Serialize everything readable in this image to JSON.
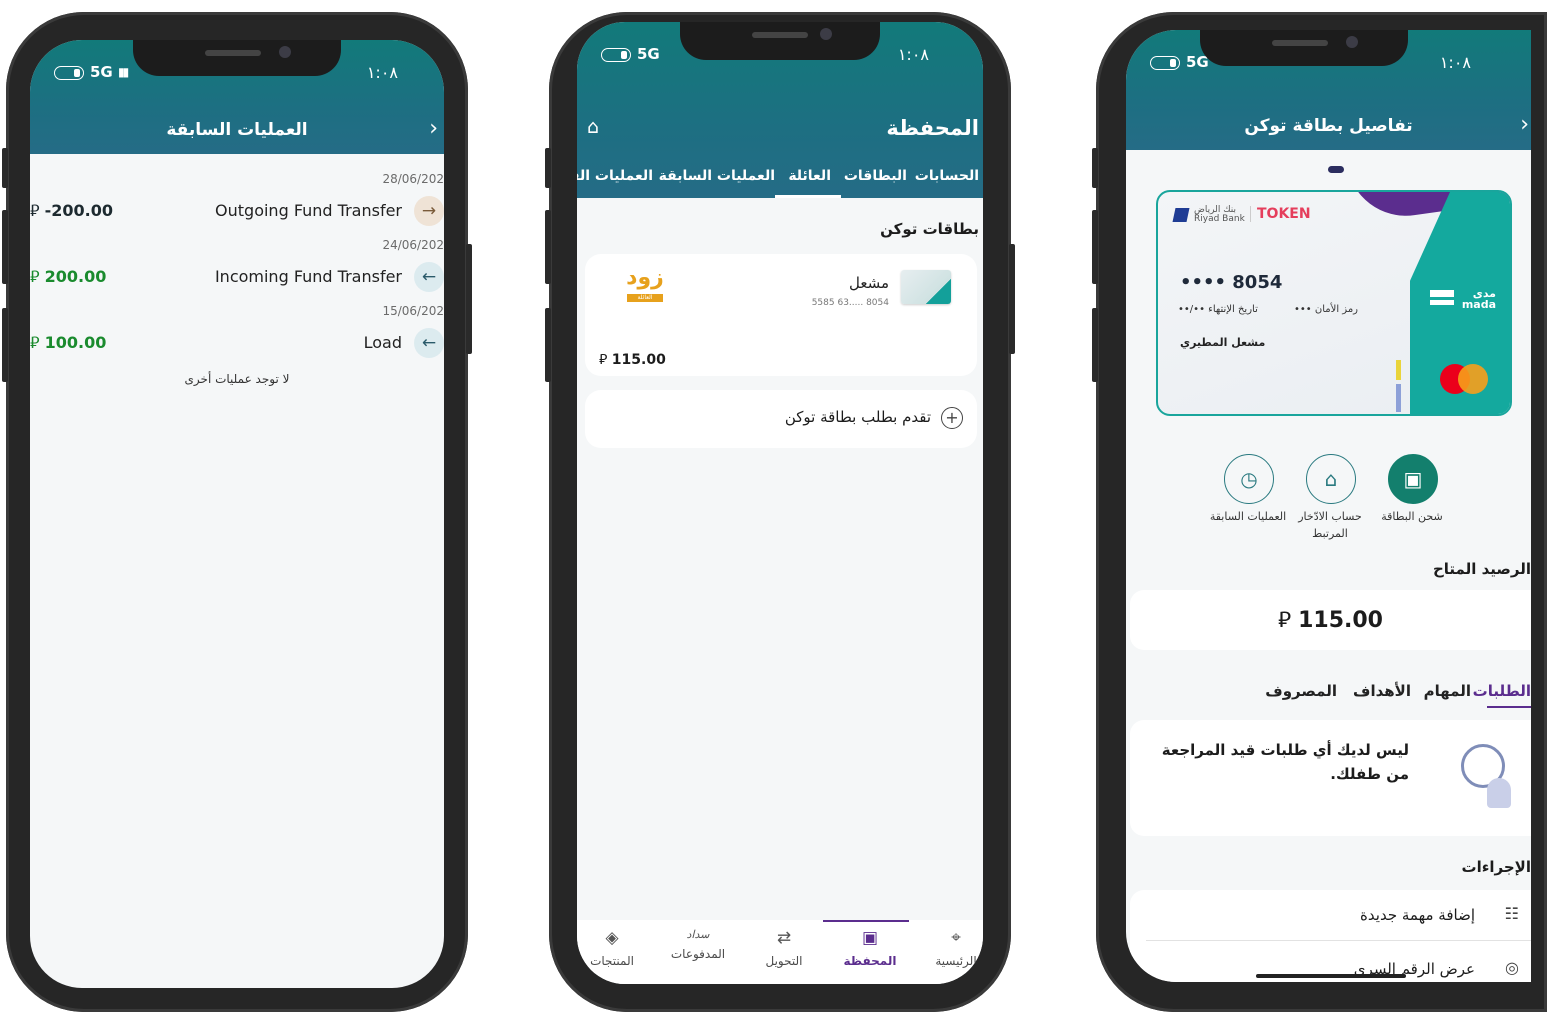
{
  "status": {
    "network": "5G",
    "time": "١:٠٨"
  },
  "screen1": {
    "title": "العمليات السابقة",
    "transactions": [
      {
        "date": "28/06/202",
        "name": "Outgoing Fund Transfer",
        "amount": "-200.00",
        "direction": "out"
      },
      {
        "date": "24/06/202",
        "name": "Incoming Fund Transfer",
        "amount": "200.00",
        "direction": "in"
      },
      {
        "date": "15/06/202",
        "name": "Load",
        "amount": "100.00",
        "direction": "in"
      }
    ],
    "empty_text": "لا توجد عمليات أخرى",
    "currency": "⃁"
  },
  "screen2": {
    "title": "المحفظة",
    "tabs": [
      "الحسابات",
      "البطاقات",
      "العائلة",
      "العمليات السابقة",
      "العمليات القا"
    ],
    "active_tab": "العائلة",
    "section_title": "بطاقات توكن",
    "card": {
      "holder": "مشعل",
      "number": "5585 63..... 8054",
      "balance": "115.00",
      "logo": "زود",
      "logo_sub": "العائلة"
    },
    "apply_label": "تقدم بطلب بطاقة توكن",
    "nav": [
      {
        "label": "الرئيسية",
        "icon": "home-icon"
      },
      {
        "label": "المحفظة",
        "icon": "wallet-icon"
      },
      {
        "label": "التحويل",
        "icon": "transfer-icon"
      },
      {
        "label": "المدفوعات",
        "icon": "sadad-icon",
        "icon_text": "سداد"
      },
      {
        "label": "المنتجات",
        "icon": "products-icon"
      }
    ],
    "active_nav": "المحفظة"
  },
  "screen3": {
    "title": "تفاصيل بطاقة توكن",
    "bank_ar": "بنك الرياض",
    "bank_en": "Riyad Bank",
    "brand": "TOKEN",
    "card_number": "•••• 8054",
    "security_label": "رمز الأمان",
    "security_value": "•••",
    "expiry_label": "تاريخ الإنتهاء",
    "expiry_value": "••/••",
    "holder_name": "مشعل المطيري",
    "mada_ar": "مدى",
    "mada_en": "mada",
    "actions": [
      {
        "label": "شحن البطاقة",
        "icon": "wallet-icon"
      },
      {
        "label": "حساب الادّخار المرتبط",
        "icon": "savings-chart-icon"
      },
      {
        "label": "العمليات السابقة",
        "icon": "history-icon"
      }
    ],
    "balance_label": "الرصيد المتاح",
    "balance": "115.00",
    "tabs": [
      "الطلبات",
      "المهام",
      "الأهداف",
      "المصروف"
    ],
    "active_tab": "الطلبات",
    "empty_text": "ليس لديك أي طلبات قيد المراجعة من طفلك.",
    "procedures_label": "الإجراءات",
    "procedures": [
      {
        "label": "إضافة مهمة جديدة",
        "icon": "clipboard-icon"
      },
      {
        "label": "عرض الرقم السري",
        "icon": "eye-off-icon"
      }
    ]
  },
  "colors": {
    "header_teal": "#127a7a",
    "accent_purple": "#5b2d8e",
    "income_green": "#1a8b2e",
    "mada_teal": "#12a39a"
  }
}
